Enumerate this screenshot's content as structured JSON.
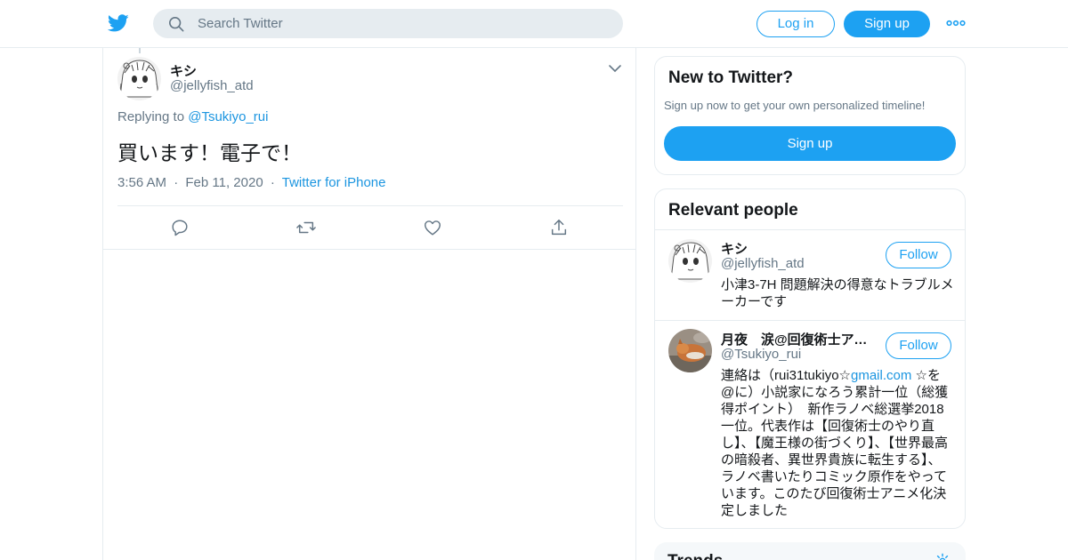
{
  "header": {
    "logo_icon": "twitter-bird-icon",
    "search_placeholder": "Search Twitter",
    "login_label": "Log in",
    "signup_label": "Sign up",
    "more_icon": "more-dots-icon"
  },
  "tweet": {
    "author_name": "キシ",
    "author_handle": "@jellyfish_atd",
    "replying_prefix": "Replying to",
    "replying_to": "@Tsukiyo_rui",
    "text": "買います！電子で！",
    "time": "3:56 AM",
    "date": "Feb 11, 2020",
    "source": "Twitter for iPhone",
    "separator": "·",
    "actions": [
      "reply-icon",
      "retweet-icon",
      "like-icon",
      "share-icon"
    ]
  },
  "new_to_twitter": {
    "title": "New to Twitter?",
    "subtitle": "Sign up now to get your own personalized timeline!",
    "signup_label": "Sign up"
  },
  "relevant_people": {
    "title": "Relevant people",
    "people": [
      {
        "name": "キシ",
        "handle": "@jellyfish_atd",
        "follow_label": "Follow",
        "bio": "小津3-7H 問題解決の得意なトラブルメーカーです"
      },
      {
        "name": "月夜　涙@回復術士アニメ化決定",
        "handle": "@Tsukiyo_rui",
        "follow_label": "Follow",
        "bio_before": "連絡は（rui31tukiyo☆",
        "bio_link": "gmail.com",
        "bio_after": " ☆を@に）小説家になろう累計一位（総獲得ポイント）　新作ラノベ総選挙2018一位。代表作は【回復術士のやり直し】、【魔王様の街づくり】、【世界最高の暗殺者、異世界貴族に転生する】、ラノベ書いたりコミック原作をやっています。このたび回復術士アニメ化決定しました"
      }
    ]
  },
  "trends": {
    "title": "Trends",
    "settings_icon": "gear-icon"
  },
  "colors": {
    "accent": "#1da1f2",
    "link": "#1b95e0",
    "muted_text": "#657786",
    "border": "#e6ecf0",
    "search_bg": "#e6ecf0"
  }
}
